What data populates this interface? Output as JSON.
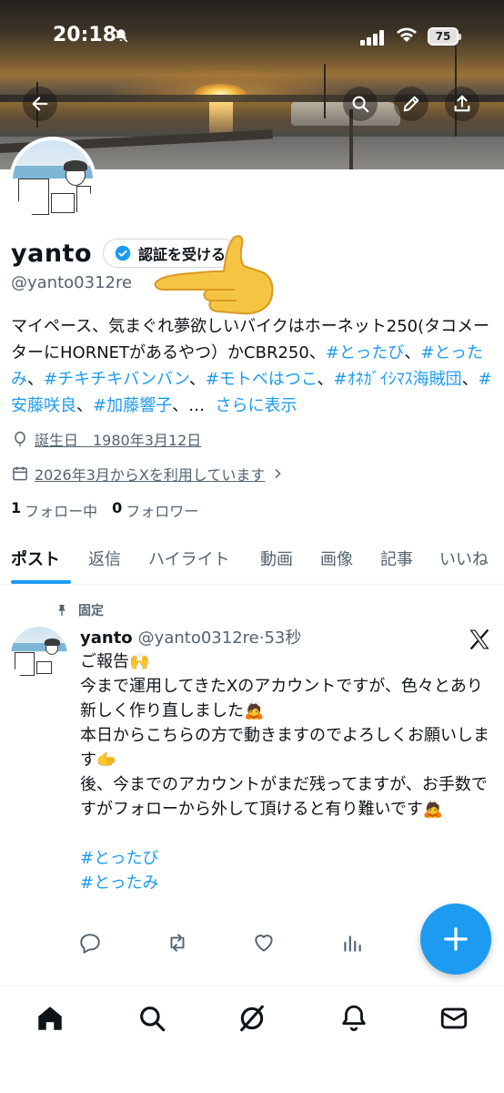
{
  "status_bar": {
    "time": "20:18",
    "battery": "75"
  },
  "profile": {
    "name": "yanto",
    "verify_label": "認証を受ける",
    "handle": "@yanto0312re",
    "bio": {
      "text1": "マイペース、気まぐれ夢",
      "text2": "欲しいバイクはホーネット250(タコメーターにHORNETがあるやつ）かCBR250、",
      "tags": [
        "#とったび",
        "#とったみ",
        "#チキチキバンバン",
        "#モトベはつこ",
        "#ｵﾈｶﾞｲｼﾏｽ海賊団",
        "#安藤咲良",
        "#加藤響子"
      ],
      "sep": "、",
      "ellipsis": "…",
      "more": "さらに表示"
    },
    "birthday": "誕生日　1980年3月12日",
    "joined": "2026年3月からXを利用しています",
    "following_count": "1",
    "following_label": "フォロー中",
    "followers_count": "0",
    "followers_label": "フォロワー"
  },
  "tabs": [
    "ポスト",
    "返信",
    "ハイライト",
    "動画",
    "画像",
    "記事",
    "いいね"
  ],
  "post": {
    "pinned_label": "固定",
    "name": "yanto",
    "handle_time": "@yanto0312re·53秒",
    "lines": [
      "ご報告🙌",
      "今まで運用してきたXのアカウントですが、色々とあり新しく作り直しました🙇",
      "本日からこちらの方で動きますのでよろしくお願いします🫱",
      "後、今までのアカウントがまだ残ってますが、お手数ですがフォローから外して頂けると有り難いです🙇"
    ],
    "tags": [
      "#とったび",
      "#とったみ"
    ]
  },
  "colors": {
    "accent": "#1d9bf0",
    "text": "#0f1419",
    "muted": "#536471"
  },
  "icons": [
    "back-arrow-icon",
    "search-icon",
    "pencil-icon",
    "share-icon",
    "verified-badge-icon",
    "balloon-icon",
    "calendar-icon",
    "chevron-right-icon",
    "pin-icon",
    "x-logo-icon",
    "reply-icon",
    "repost-icon",
    "like-icon",
    "views-icon",
    "plus-icon",
    "home-icon",
    "grok-icon",
    "bell-icon",
    "mail-icon"
  ]
}
